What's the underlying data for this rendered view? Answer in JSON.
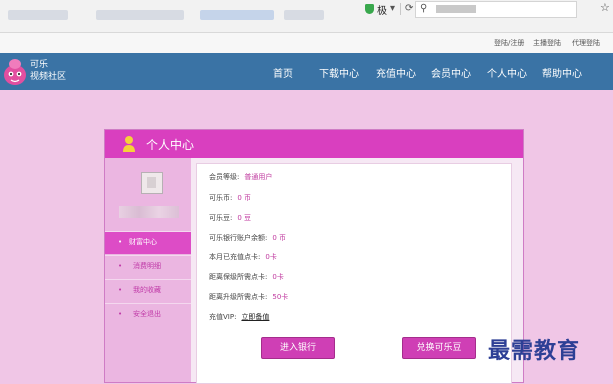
{
  "browser": {
    "compat_label": "极",
    "refresh_icon": "refresh-icon",
    "search_icon": "search-icon",
    "star_icon": "star-icon"
  },
  "toplinks": [
    "登陆/注册",
    "主播登陆",
    "代理登陆"
  ],
  "logo": {
    "line1": "可乐",
    "line2": "视频社区"
  },
  "nav": [
    "首页",
    "下载中心",
    "充值中心",
    "会员中心",
    "个人中心",
    "帮助中心"
  ],
  "panel": {
    "title": "个人中心",
    "menu": [
      {
        "label": "财富中心",
        "active": true
      },
      {
        "label": "消费明细",
        "active": false
      },
      {
        "label": "我的收藏",
        "active": false
      },
      {
        "label": "安全退出",
        "active": false
      }
    ],
    "rows": [
      {
        "label": "会员等级:",
        "value": "普通用户"
      },
      {
        "label": "可乐币:",
        "value": "0 币"
      },
      {
        "label": "可乐豆:",
        "value": "0 豆"
      },
      {
        "label": "可乐银行账户余额:",
        "value": "0 币"
      },
      {
        "label": "本月已充值点卡:",
        "value": "0卡"
      },
      {
        "label": "距离保级所需点卡:",
        "value": "0卡"
      },
      {
        "label": "距离升级所需点卡:",
        "value": "50卡"
      }
    ],
    "vip": {
      "label": "充值VIP:",
      "link": "立即备值"
    },
    "buttons": {
      "bank": "进入银行",
      "exchange": "兑换可乐豆"
    }
  },
  "watermark": "最需教育"
}
